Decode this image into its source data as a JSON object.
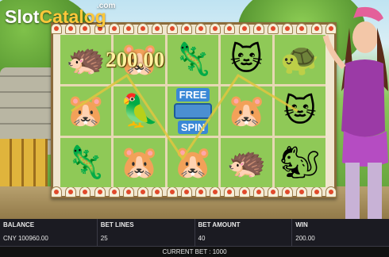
{
  "logo": {
    "prefix": "Slot",
    "suffix": "Catalog",
    "com": ".com"
  },
  "win_display": "200.00",
  "reels": [
    [
      "🦔",
      "🐹",
      "🦎",
      "🐱",
      "🐢"
    ],
    [
      "🐹",
      "🦜",
      "FREE_SPIN",
      "🐹",
      "🐱"
    ],
    [
      "🦎",
      "🐹",
      "🐹",
      "🦔",
      "🐿"
    ]
  ],
  "free_spin": {
    "line1": "FREE",
    "line2": "SPIN"
  },
  "status": {
    "balance_label": "BALANCE",
    "balance_value": "CNY 100960.00",
    "bet_lines_label": "BET LINES",
    "bet_lines_value": "25",
    "bet_amount_label": "BET AMOUNT",
    "bet_amount_value": "40",
    "win_label": "WIN",
    "win_value": "200.00",
    "current_bet": "CURRENT BET : 1000"
  },
  "colors": {
    "cell_green": "#8fc957",
    "payline": "#e0c640",
    "bar_bg": "#1b1b22"
  }
}
